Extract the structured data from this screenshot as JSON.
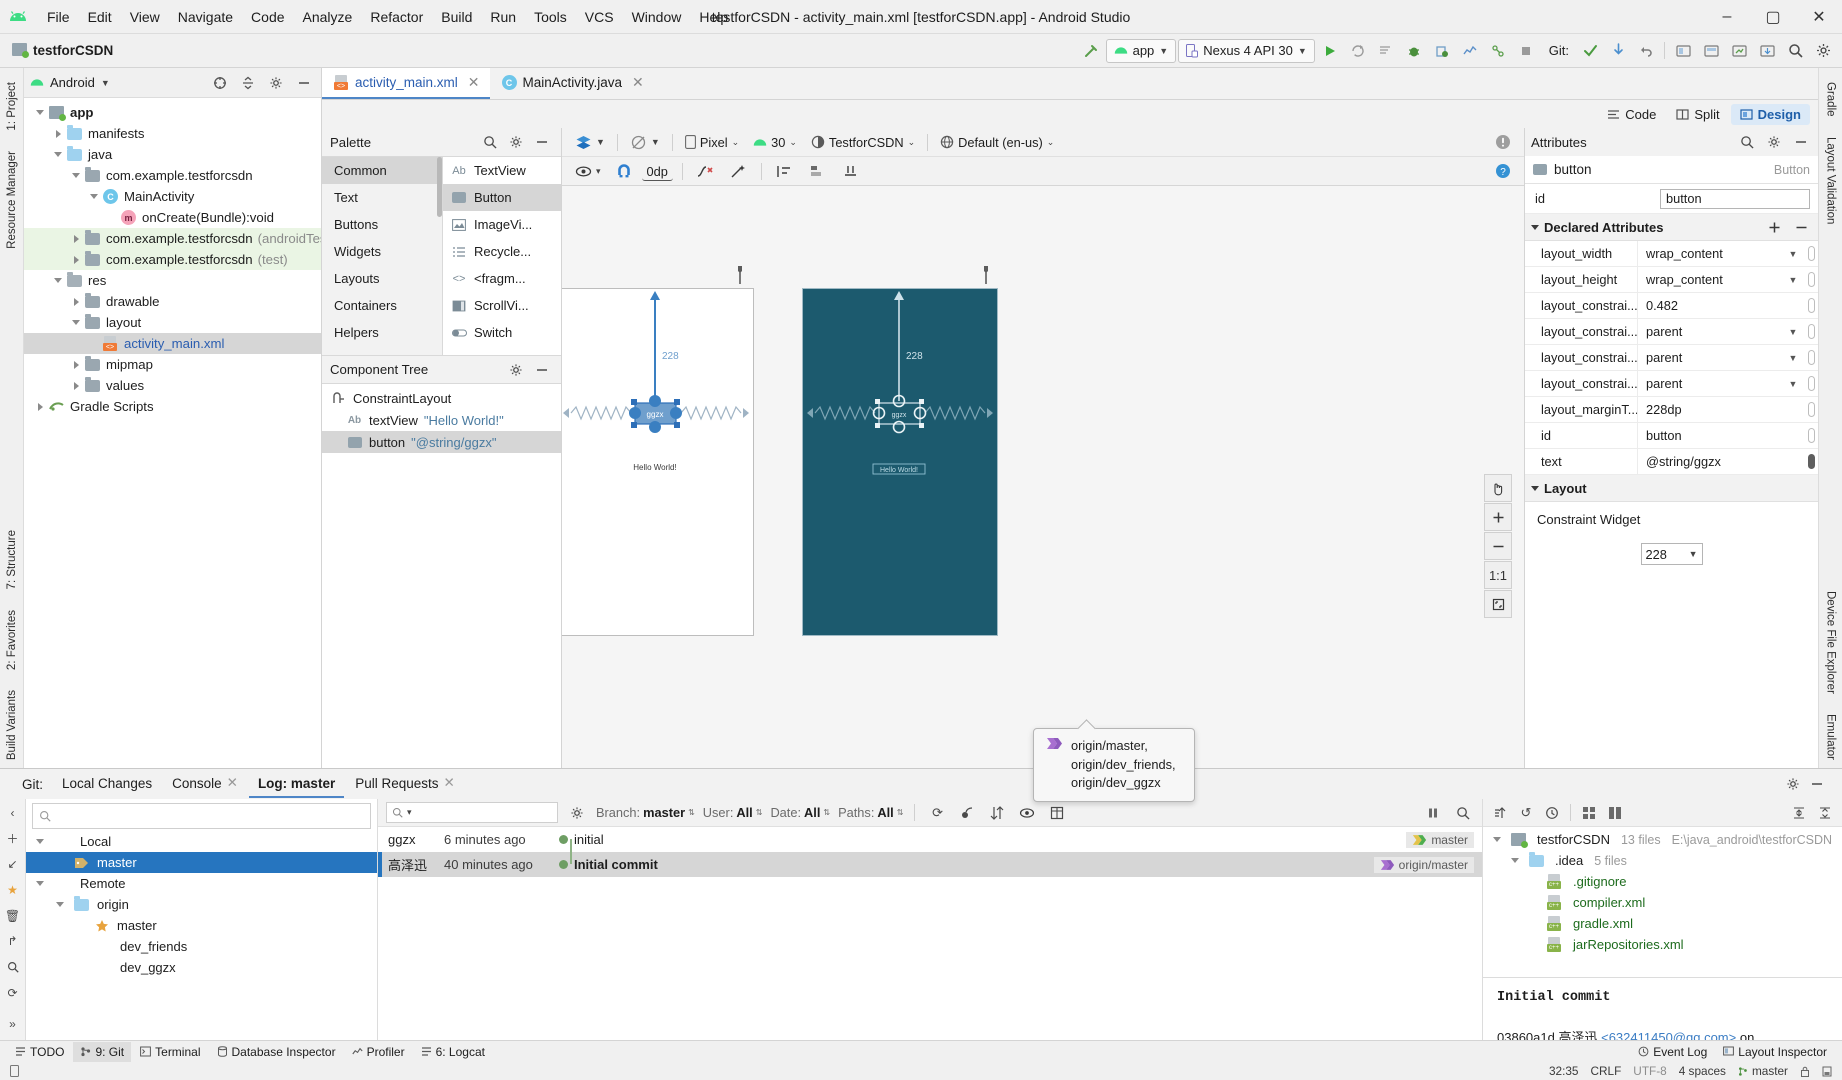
{
  "window": {
    "title": "testforCSDN - activity_main.xml [testforCSDN.app] - Android Studio",
    "minimize": "–",
    "maximize": "▢",
    "close": "✕"
  },
  "menu": [
    "File",
    "Edit",
    "View",
    "Navigate",
    "Code",
    "Analyze",
    "Refactor",
    "Build",
    "Run",
    "Tools",
    "VCS",
    "Window",
    "Help"
  ],
  "toolbar": {
    "project_name": "testforCSDN",
    "module": "app",
    "device": "Nexus 4 API 30",
    "git_label": "Git:",
    "icons": [
      "build-hammer-icon",
      "run-icon",
      "apply-changes-icon",
      "apply-code-changes-icon",
      "debug-icon",
      "attach-debugger-icon",
      "profiler-icon",
      "device-manager-icon",
      "stop-icon",
      "commit-check-icon",
      "update-project-icon",
      "undo-icon",
      "layout-inspector-icon",
      "avd-manager-icon",
      "sdk-manager-icon",
      "device-file-explorer-icon",
      "search-everywhere-icon",
      "settings-icon"
    ]
  },
  "left_strip": [
    "1: Project",
    "Resource Manager",
    "7: Structure",
    "2: Favorites",
    "Build Variants"
  ],
  "right_strip": [
    "Gradle",
    "Layout Validation",
    "Device File Explorer",
    "Emulator"
  ],
  "project": {
    "selector": "Android",
    "tree": [
      {
        "label": "app",
        "sub": "",
        "depth": 0,
        "arrow": "down",
        "icon": "module-icon",
        "bold": true
      },
      {
        "label": "manifests",
        "sub": "",
        "depth": 1,
        "arrow": "right",
        "icon": "folder-blue-icon"
      },
      {
        "label": "java",
        "sub": "",
        "depth": 1,
        "arrow": "down",
        "icon": "folder-blue-icon"
      },
      {
        "label": "com.example.testforcsdn",
        "sub": "",
        "depth": 2,
        "arrow": "down",
        "icon": "package-icon"
      },
      {
        "label": "MainActivity",
        "sub": "",
        "depth": 3,
        "arrow": "down",
        "icon": "class-icon"
      },
      {
        "label": "onCreate(Bundle):void",
        "sub": "",
        "depth": 4,
        "arrow": "none",
        "icon": "method-icon"
      },
      {
        "label": "com.example.testforcsdn",
        "sub": "(androidTest)",
        "depth": 2,
        "arrow": "right",
        "icon": "package-icon",
        "green": true
      },
      {
        "label": "com.example.testforcsdn",
        "sub": "(test)",
        "depth": 2,
        "arrow": "right",
        "icon": "package-icon",
        "green": true
      },
      {
        "label": "res",
        "sub": "",
        "depth": 1,
        "arrow": "down",
        "icon": "res-folder-icon"
      },
      {
        "label": "drawable",
        "sub": "",
        "depth": 2,
        "arrow": "right",
        "icon": "package-icon"
      },
      {
        "label": "layout",
        "sub": "",
        "depth": 2,
        "arrow": "down",
        "icon": "package-icon"
      },
      {
        "label": "activity_main.xml",
        "sub": "",
        "depth": 3,
        "arrow": "none",
        "icon": "xml-layout-icon",
        "selected": true,
        "blue": true
      },
      {
        "label": "mipmap",
        "sub": "",
        "depth": 2,
        "arrow": "right",
        "icon": "package-icon"
      },
      {
        "label": "values",
        "sub": "",
        "depth": 2,
        "arrow": "right",
        "icon": "package-icon"
      },
      {
        "label": "Gradle Scripts",
        "sub": "",
        "depth": 0,
        "arrow": "right",
        "icon": "gradle-icon"
      }
    ]
  },
  "editor": {
    "tabs": [
      {
        "label": "activity_main.xml",
        "icon": "xml-layout-icon",
        "active": true,
        "closable": true
      },
      {
        "label": "MainActivity.java",
        "icon": "class-icon",
        "active": false,
        "closable": true
      }
    ],
    "modes": [
      {
        "label": "Code",
        "active": false
      },
      {
        "label": "Split",
        "active": false
      },
      {
        "label": "Design",
        "active": true
      }
    ]
  },
  "palette": {
    "title": "Palette",
    "categories": [
      {
        "label": "Common",
        "selected": true
      },
      {
        "label": "Text"
      },
      {
        "label": "Buttons"
      },
      {
        "label": "Widgets"
      },
      {
        "label": "Layouts"
      },
      {
        "label": "Containers"
      },
      {
        "label": "Helpers"
      }
    ],
    "items": [
      {
        "label": "TextView",
        "glyph": "Ab"
      },
      {
        "label": "Button",
        "glyph": "button-icon",
        "selected": true
      },
      {
        "label": "ImageVi...",
        "glyph": "image-icon"
      },
      {
        "label": "Recycle...",
        "glyph": "list-icon"
      },
      {
        "label": "<fragm...",
        "glyph": "code-icon"
      },
      {
        "label": "ScrollVi...",
        "glyph": "scroll-icon"
      },
      {
        "label": "Switch",
        "glyph": "switch-icon"
      }
    ]
  },
  "component_tree": {
    "title": "Component Tree",
    "nodes": [
      {
        "label": "ConstraintLayout",
        "value": "",
        "depth": 0,
        "icon": "constraint-layout-icon"
      },
      {
        "label": "textView",
        "value": "\"Hello World!\"",
        "depth": 1,
        "icon": "textview-icon"
      },
      {
        "label": "button",
        "value": "\"@string/ggzx\"",
        "depth": 1,
        "icon": "button-icon",
        "selected": true
      }
    ]
  },
  "design_toolbar": {
    "device": "Pixel",
    "api": "30",
    "theme": "TestforCSDN",
    "locale": "Default (en-us)",
    "margin": "0dp",
    "icons_row1": [
      "design-surface-icon",
      "orientation-icon",
      "device-icon",
      "api-icon",
      "theme-icon",
      "locale-icon",
      "warning-icon"
    ],
    "icons_row2": [
      "eye-icon",
      "magnet-icon",
      "clear-constraints-icon",
      "infer-constraints-icon",
      "align-icon",
      "guidelines-icon",
      "baseline-icon",
      "help-icon"
    ],
    "zoom_buttons": [
      "pan-icon",
      "zoom-in-icon",
      "zoom-out-icon",
      "zoom-actual-icon",
      "zoom-fit-icon"
    ],
    "zoom_actual_label": "1:1"
  },
  "canvas": {
    "preview_text": "Hello World!",
    "button_text": "ggzx",
    "constraint_value": "228"
  },
  "attributes": {
    "title": "Attributes",
    "component": "button",
    "component_type": "Button",
    "id_label": "id",
    "id_value": "button",
    "declared_header": "Declared Attributes",
    "rows": [
      {
        "key": "layout_width",
        "value": "wrap_content",
        "dropdown": true,
        "filled": false
      },
      {
        "key": "layout_height",
        "value": "wrap_content",
        "dropdown": true,
        "filled": false
      },
      {
        "key": "layout_constrai...",
        "value": "0.482",
        "dropdown": false,
        "filled": false
      },
      {
        "key": "layout_constrai...",
        "value": "parent",
        "dropdown": true,
        "filled": false
      },
      {
        "key": "layout_constrai...",
        "value": "parent",
        "dropdown": true,
        "filled": false
      },
      {
        "key": "layout_constrai...",
        "value": "parent",
        "dropdown": true,
        "filled": false
      },
      {
        "key": "layout_marginT...",
        "value": "228dp",
        "dropdown": false,
        "filled": false
      },
      {
        "key": "id",
        "value": "button",
        "dropdown": false,
        "filled": false
      },
      {
        "key": "text",
        "value": "@string/ggzx",
        "dropdown": false,
        "filled": true
      }
    ],
    "layout_header": "Layout",
    "constraint_widget_label": "Constraint Widget",
    "constraint_widget_value": "228"
  },
  "git": {
    "tabs": [
      {
        "label": "Git:",
        "static": true
      },
      {
        "label": "Local Changes"
      },
      {
        "label": "Console",
        "closable": true
      },
      {
        "label": "Log: master",
        "active": true
      },
      {
        "label": "Pull Requests",
        "closable": true
      }
    ],
    "branch_search_placeholder": "",
    "branches": [
      {
        "label": "Local",
        "depth": 0,
        "arrow": "down",
        "icon": "none"
      },
      {
        "label": "master",
        "depth": 1,
        "arrow": "none",
        "icon": "branch-tag-icon",
        "selected": true
      },
      {
        "label": "Remote",
        "depth": 0,
        "arrow": "down",
        "icon": "none"
      },
      {
        "label": "origin",
        "depth": 1,
        "arrow": "down",
        "icon": "folder-blue-icon"
      },
      {
        "label": "master",
        "depth": 2,
        "arrow": "none",
        "icon": "star-icon"
      },
      {
        "label": "dev_friends",
        "depth": 2,
        "arrow": "none",
        "icon": "none"
      },
      {
        "label": "dev_ggzx",
        "depth": 2,
        "arrow": "none",
        "icon": "none"
      }
    ],
    "log_filters": [
      {
        "label": "Branch:",
        "value": "master"
      },
      {
        "label": "User:",
        "value": "All"
      },
      {
        "label": "Date:",
        "value": "All"
      },
      {
        "label": "Paths:",
        "value": "All"
      }
    ],
    "log_search_placeholder": "",
    "commits": [
      {
        "author": "ggzx",
        "time": "6 minutes ago",
        "subject": "initial",
        "ref": "master",
        "ref_kind": "local",
        "selected": false
      },
      {
        "author": "高泽迅",
        "time": "40 minutes ago",
        "subject": "Initial commit",
        "ref": "origin/master",
        "ref_kind": "remote",
        "selected": true
      }
    ],
    "tooltip": [
      "origin/master,",
      "origin/dev_friends,",
      "origin/dev_ggzx"
    ],
    "detail": {
      "files": [
        {
          "label": "testforCSDN",
          "meta": "13 files",
          "path": "E:\\java_android\\testforCSDN",
          "depth": 0,
          "arrow": "down",
          "icon": "module-icon"
        },
        {
          "label": ".idea",
          "meta": "5 files",
          "path": "",
          "depth": 1,
          "arrow": "down",
          "icon": "folder-blue-icon"
        },
        {
          "label": ".gitignore",
          "meta": "",
          "path": "",
          "depth": 2,
          "arrow": "none",
          "icon": "file-icon"
        },
        {
          "label": "compiler.xml",
          "meta": "",
          "path": "",
          "depth": 2,
          "arrow": "none",
          "icon": "file-icon"
        },
        {
          "label": "gradle.xml",
          "meta": "",
          "path": "",
          "depth": 2,
          "arrow": "none",
          "icon": "file-icon"
        },
        {
          "label": "jarRepositories.xml",
          "meta": "",
          "path": "",
          "depth": 2,
          "arrow": "none",
          "icon": "file-icon"
        }
      ],
      "commit_title": "Initial commit",
      "commit_meta_hash": "03860a1d",
      "commit_meta_author": "高泽迅",
      "commit_meta_email": "<632411450@qq.com>",
      "commit_meta_tail": "on"
    }
  },
  "status": {
    "tabs": [
      {
        "label": "TODO",
        "icon": "todo-icon"
      },
      {
        "label": "9: Git",
        "icon": "git-icon",
        "active": true
      },
      {
        "label": "Terminal",
        "icon": "terminal-icon"
      },
      {
        "label": "Database Inspector",
        "icon": "database-icon"
      },
      {
        "label": "Profiler",
        "icon": "profiler-icon"
      },
      {
        "label": "6: Logcat",
        "icon": "logcat-icon"
      }
    ],
    "right_tabs": [
      {
        "label": "Event Log",
        "icon": "event-log-icon"
      },
      {
        "label": "Layout Inspector",
        "icon": "layout-inspector-icon"
      }
    ],
    "caret": "32:35",
    "line_sep": "CRLF",
    "encoding": "UTF-8",
    "indent": "4 spaces",
    "branch": "master"
  },
  "colors": {
    "accent": "#4e86c7",
    "selection": "#2675bf",
    "blueprint": "#1c5a6e",
    "green": "#62b543"
  }
}
